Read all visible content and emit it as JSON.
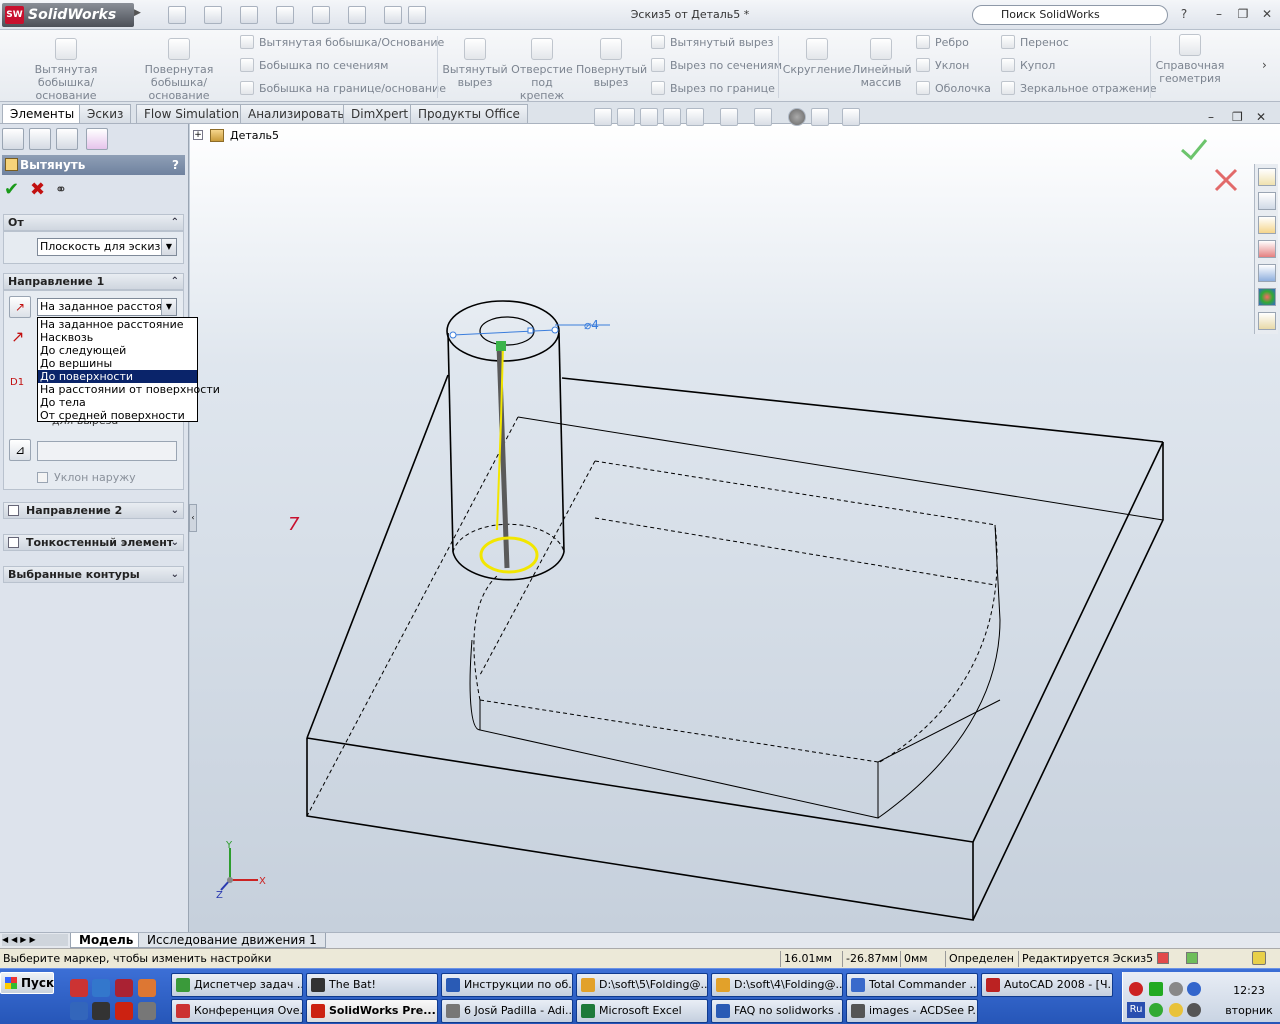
{
  "app": {
    "logo_text": "SolidWorks",
    "logo_badge": "SW",
    "document_title": "Эскиз5 от Деталь5 *",
    "search_placeholder": "Поиск SolidWorks",
    "window_controls": [
      "?",
      "–",
      "❐",
      "✕"
    ]
  },
  "command_manager": {
    "big_buttons": [
      {
        "label": "Вытянутая бобышка/основание",
        "icon": "extruded-boss-icon"
      },
      {
        "label": "Повернутая бобышка/основание",
        "icon": "revolved-boss-icon"
      },
      {
        "label": "Вытянутый вырез",
        "icon": "extruded-cut-icon"
      },
      {
        "label": "Отверстие под крепеж",
        "icon": "hole-wizard-icon"
      },
      {
        "label": "Повернутый вырез",
        "icon": "revolved-cut-icon"
      },
      {
        "label": "Скругление",
        "icon": "fillet-icon"
      },
      {
        "label": "Линейный массив",
        "icon": "linear-pattern-icon"
      },
      {
        "label": "Справочная геометрия",
        "icon": "reference-geometry-icon"
      }
    ],
    "small_buttons": [
      {
        "label": "Вытянутая бобышка/Основание",
        "icon": "swept-boss-icon"
      },
      {
        "label": "Бобышка по сечениям",
        "icon": "lofted-boss-icon"
      },
      {
        "label": "Бобышка на границе/основание",
        "icon": "boundary-boss-icon"
      },
      {
        "label": "Вытянутый вырез",
        "icon": "swept-cut-icon"
      },
      {
        "label": "Вырез по сечениям",
        "icon": "lofted-cut-icon"
      },
      {
        "label": "Вырез по границе",
        "icon": "boundary-cut-icon"
      },
      {
        "label": "Ребро",
        "icon": "rib-icon"
      },
      {
        "label": "Уклон",
        "icon": "draft-icon"
      },
      {
        "label": "Оболочка",
        "icon": "shell-icon"
      },
      {
        "label": "Перенос",
        "icon": "wrap-icon"
      },
      {
        "label": "Купол",
        "icon": "dome-icon"
      },
      {
        "label": "Зеркальное отражение",
        "icon": "mirror-icon"
      }
    ]
  },
  "tabs": [
    {
      "label": "Элементы",
      "active": true
    },
    {
      "label": "Эскиз",
      "active": false
    },
    {
      "label": "Flow Simulation",
      "active": false
    },
    {
      "label": "Анализировать",
      "active": false
    },
    {
      "label": "DimXpert",
      "active": false
    },
    {
      "label": "Продукты Office",
      "active": false
    }
  ],
  "property_manager": {
    "title": "Вытянуть",
    "help": "?",
    "from_group": {
      "title": "От",
      "value": "Плоскость для эскиза"
    },
    "direction1": {
      "title": "Направление 1",
      "end_condition": "На заданное расстояние",
      "options": [
        "На заданное расстояние",
        "Насквозь",
        "До следующей",
        "До вершины",
        "До поверхности",
        "На расстоянии от поверхности",
        "До тела",
        "От средней поверхности"
      ],
      "selected_option_index": 4,
      "depth_label": "D1",
      "obscured_text": "для выреза",
      "draft_outward": "Уклон наружу"
    },
    "direction2": {
      "title": "Направление 2"
    },
    "thin_feature": {
      "title": "Тонкостенный элемент"
    },
    "selected_contours": {
      "title": "Выбранные контуры"
    }
  },
  "feature_tree": {
    "root_label": "Деталь5"
  },
  "viewport": {
    "dimension_label": "⌀4",
    "triad": {
      "x": "X",
      "y": "Y",
      "z": "Z"
    },
    "marker_label": "7",
    "colors": {
      "edge": "#000000",
      "preview": "#f2e600",
      "dimension": "#3a7ddc",
      "confirm": "#6cc46c",
      "cancel": "#e26a6a"
    }
  },
  "bottom_tabs": [
    {
      "label": "Модель",
      "active": true
    },
    {
      "label": "Исследование движения 1",
      "active": false
    }
  ],
  "status_bar": {
    "message": "Выберите маркер, чтобы изменить настройки",
    "x": "16.01мм",
    "y": "-26.87мм",
    "z": "0мм",
    "state": "Определен",
    "editing": "Редактируется Эскиз5"
  },
  "taskbar": {
    "start_label": "Пуск",
    "row1": [
      {
        "label": "Диспетчер задач ...",
        "icon": "task-manager-icon"
      },
      {
        "label": "The Bat!",
        "icon": "the-bat-icon"
      },
      {
        "label": "Инструкции по об...",
        "icon": "document-icon"
      },
      {
        "label": "D:\\soft\\5\\Folding@...",
        "icon": "folder-icon"
      },
      {
        "label": "D:\\soft\\4\\Folding@...",
        "icon": "folder-icon"
      },
      {
        "label": "Total Commander ...",
        "icon": "total-commander-icon"
      },
      {
        "label": "AutoCAD 2008 - [Ч...",
        "icon": "autocad-icon"
      }
    ],
    "row2": [
      {
        "label": "Конференция Ove...",
        "icon": "chat-icon"
      },
      {
        "label": "SolidWorks Pre...",
        "icon": "solidworks-icon",
        "active": true
      },
      {
        "label": "6 Josй Padilla - Adi...",
        "icon": "music-icon"
      },
      {
        "label": "Microsoft Excel",
        "icon": "excel-icon"
      },
      {
        "label": "FAQ no solidworks ...",
        "icon": "document-icon"
      },
      {
        "label": "images - ACDSee P...",
        "icon": "acdsee-icon"
      }
    ],
    "tray": {
      "lang": "Ru",
      "time": "12:23",
      "day": "вторник"
    }
  }
}
